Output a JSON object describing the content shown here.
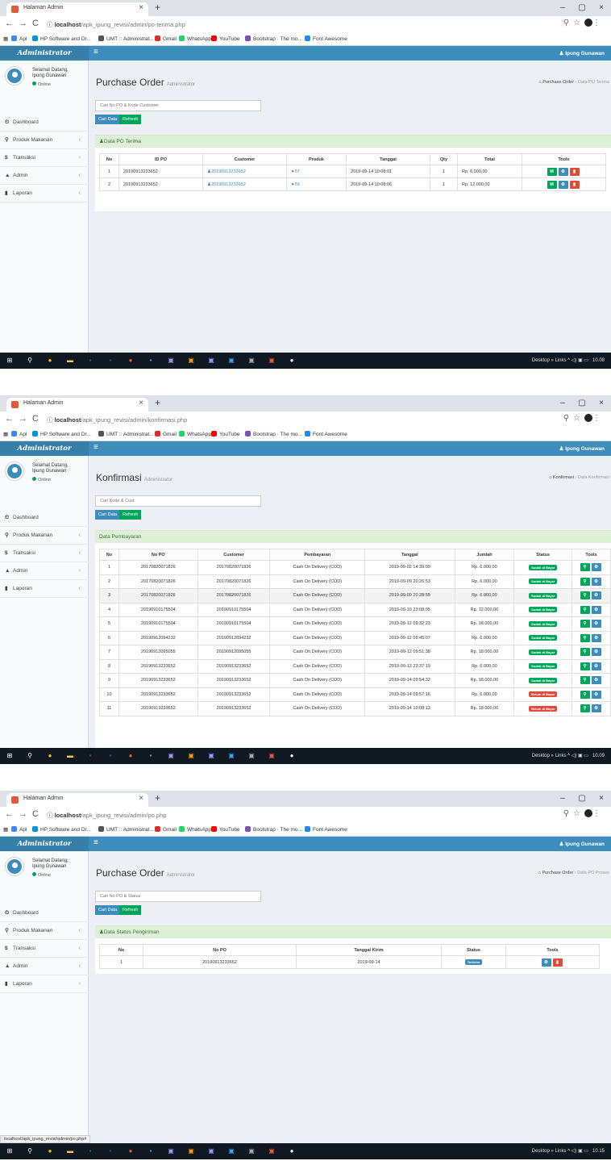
{
  "browser": {
    "tab_title": "Halaman Admin",
    "tab_close": "×",
    "new_tab": "+",
    "win_min": "–",
    "win_max": "▢",
    "win_close": "×",
    "url_host": "localhost",
    "bookmarks": [
      "Apl",
      "HP Software and Dr...",
      "UMT :: Administrat...",
      "Gmail",
      "WhatsApp",
      "YouTube",
      "Bootstrap · The mo...",
      "Font Awesome"
    ]
  },
  "app": {
    "logo": "Administrator",
    "user_name": "Ipung Gunawan",
    "greeting_1": "Selamat Datang,",
    "greeting_2": "Ipung Gunawan",
    "status": "Online",
    "menu": [
      {
        "label": "Dashboard",
        "icon": "⏲"
      },
      {
        "label": "Produk Makanan",
        "icon": "⚲"
      },
      {
        "label": "Transaksi",
        "icon": "$"
      },
      {
        "label": "Admin",
        "icon": "▲"
      },
      {
        "label": "Laporan",
        "icon": "▮"
      }
    ],
    "btn_search": "Cari Data",
    "btn_refresh": "Refresh"
  },
  "taskbar": {
    "desktop": "Desktop",
    "links": "Links",
    "times": [
      "10.08",
      "10.09",
      "10.15"
    ]
  },
  "screen1": {
    "url_path": "/apk_ipung_revisi/admin/po-terima.php",
    "title": "Purchase Order",
    "subtitle": "Administrator",
    "crumb_home": "Purchase Order",
    "crumb_current": "Data PO Terima",
    "search_placeholder": "Cari No PO & Kode Customer",
    "box_title": "Data PO Terima",
    "headers": [
      "No",
      "ID PO",
      "Customer",
      "Produk",
      "Tanggal",
      "Qty",
      "Total",
      "Tools"
    ],
    "rows": [
      {
        "no": "1",
        "id": "20190913233652",
        "customer": "20190913233652",
        "produk": "57",
        "tanggal": "2019-09-14 10:08:01",
        "qty": "1",
        "total": "Rp. 6.000,00",
        "tool": "M"
      },
      {
        "no": "2",
        "id": "20190913233652",
        "customer": "20190913233652",
        "produk": "59",
        "tanggal": "2019-09-14 10:08:06",
        "qty": "1",
        "total": "Rp. 12.000,00",
        "tool": "M"
      }
    ]
  },
  "screen2": {
    "url_path": "/apk_ipung_revisi/admin/konfirmasi.php",
    "title": "Konfirmasi",
    "subtitle": "Administrator",
    "crumb_home": "Konfirmasi",
    "crumb_current": "Data Konfirmasi",
    "search_placeholder": "Cari Kode & Cust",
    "box_title": "Data Pembayaran",
    "headers": [
      "No",
      "No PO",
      "Customer",
      "Pembayaran",
      "Tanggal",
      "Jumlah",
      "Status",
      "Tools"
    ],
    "rows": [
      {
        "no": "1",
        "po": "20170820071826",
        "customer": "20170820071826",
        "bayar": "Cash On Delivery (COD)",
        "tanggal": "2019-09-02 14:39:09",
        "jumlah": "Rp. 6.000,00",
        "status": "Sudah di Bayar",
        "paid": true
      },
      {
        "no": "2",
        "po": "20170820071826",
        "customer": "20170820071826",
        "bayar": "Cash On Delivery (COD)",
        "tanggal": "2019-09-09 20:26:53",
        "jumlah": "Rp. 6.000,00",
        "status": "Sudah di Bayar",
        "paid": true
      },
      {
        "no": "3",
        "po": "20170820071826",
        "customer": "20170820071826",
        "bayar": "Cash On Delivery (COD)",
        "tanggal": "2019-09-09 20:28:55",
        "jumlah": "Rp. 6.000,00",
        "status": "Sudah di Bayar",
        "paid": true
      },
      {
        "no": "4",
        "po": "20190910175504",
        "customer": "20190910175504",
        "bayar": "Cash On Delivery (COD)",
        "tanggal": "2019-09-10 23:08:05",
        "jumlah": "Rp. 12.000,00",
        "status": "Sudah di Bayar",
        "paid": true
      },
      {
        "no": "5",
        "po": "20190910175504",
        "customer": "20190910175504",
        "bayar": "Cash On Delivery (COD)",
        "tanggal": "2019-09-12 09:32:23",
        "jumlah": "Rp. 18.000,00",
        "status": "Sudah di Bayar",
        "paid": true
      },
      {
        "no": "6",
        "po": "20190912094232",
        "customer": "20190912094232",
        "bayar": "Cash On Delivery (COD)",
        "tanggal": "2019-09-12 09:45:07",
        "jumlah": "Rp. 6.000,00",
        "status": "Sudah di Bayar",
        "paid": true
      },
      {
        "no": "7",
        "po": "20190912095055",
        "customer": "20190912095055",
        "bayar": "Cash On Delivery (COD)",
        "tanggal": "2019-09-12 09:51:38",
        "jumlah": "Rp. 18.000,00",
        "status": "Sudah di Bayar",
        "paid": true
      },
      {
        "no": "8",
        "po": "20190913233652",
        "customer": "20190913233652",
        "bayar": "Cash On Delivery (COD)",
        "tanggal": "2019-09-13 23:37:19",
        "jumlah": "Rp. 6.000,00",
        "status": "Sudah di Bayar",
        "paid": true
      },
      {
        "no": "9",
        "po": "20190913233652",
        "customer": "20190913233652",
        "bayar": "Cash On Delivery (COD)",
        "tanggal": "2019-09-14 09:54:32",
        "jumlah": "Rp. 18.000,00",
        "status": "Sudah di Bayar",
        "paid": true
      },
      {
        "no": "10",
        "po": "20190913233652",
        "customer": "20190913233652",
        "bayar": "Cash On Delivery (COD)",
        "tanggal": "2019-09-14 09:57:16",
        "jumlah": "Rp. 6.000,00",
        "status": "Belum di Bayar",
        "paid": false
      },
      {
        "no": "11",
        "po": "20190913233652",
        "customer": "20190913233652",
        "bayar": "Cash On Delivery (COD)",
        "tanggal": "2019-09-14 10:08:13",
        "jumlah": "Rp. 18.000,00",
        "status": "Belum di Bayar",
        "paid": false
      }
    ]
  },
  "screen3": {
    "url_path": "/apk_ipung_revisi/admin/po.php",
    "title": "Purchase Order",
    "subtitle": "Administrator",
    "crumb_home": "Purchase Order",
    "crumb_current": "Data PO Proses",
    "search_placeholder": "Cari No PO & Status",
    "box_title": "Data Status Pengiriman",
    "headers": [
      "No",
      "No PO",
      "Tanggal Kirim",
      "Status",
      "Tools"
    ],
    "rows": [
      {
        "no": "1",
        "po": "20190913233652",
        "tanggal": "2019-09-14",
        "status": "Terkirim"
      }
    ],
    "status_url": "localhost/apk_ipung_revisi/admin/po.php#"
  }
}
